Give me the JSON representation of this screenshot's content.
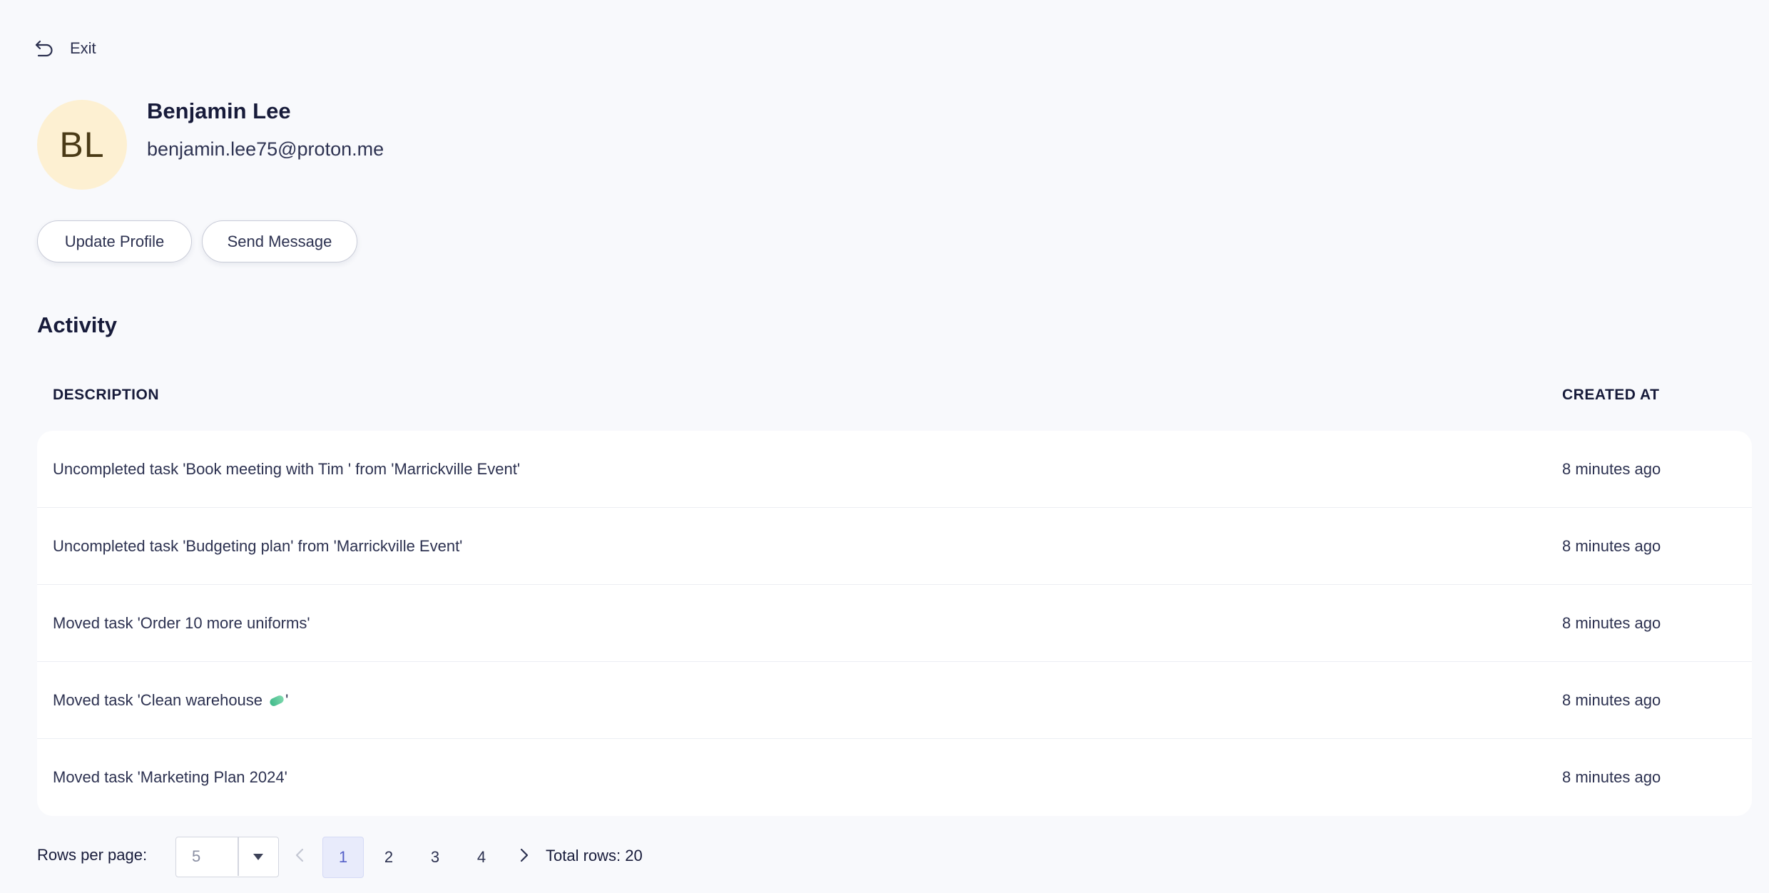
{
  "header": {
    "exit_label": "Exit"
  },
  "profile": {
    "initials": "BL",
    "name": "Benjamin Lee",
    "email": "benjamin.lee75@proton.me",
    "avatar_color": "#fdf0d2"
  },
  "actions": {
    "update_profile_label": "Update Profile",
    "send_message_label": "Send Message"
  },
  "activity": {
    "title": "Activity",
    "columns": {
      "description": "DESCRIPTION",
      "created_at": "CREATED AT"
    },
    "rows": [
      {
        "description": "Uncompleted task 'Book meeting with Tim ' from 'Marrickville Event'",
        "created_at": "8 minutes ago"
      },
      {
        "description": "Uncompleted task 'Budgeting plan' from 'Marrickville Event'",
        "created_at": "8 minutes ago"
      },
      {
        "description": "Moved task 'Order 10 more uniforms'",
        "created_at": "8 minutes ago"
      },
      {
        "description_prefix": "Moved task 'Clean warehouse ",
        "description_icon": "pill-emoji-icon",
        "description_suffix": "'",
        "created_at": "8 minutes ago"
      },
      {
        "description": "Moved task 'Marketing Plan 2024'",
        "created_at": "8 minutes ago"
      }
    ]
  },
  "pagination": {
    "rows_per_page_label": "Rows per page:",
    "rows_per_page_value": "5",
    "pages": [
      "1",
      "2",
      "3",
      "4"
    ],
    "current_page": "1",
    "total_label": "Total rows: 20",
    "accent_color": "#5560c8"
  }
}
